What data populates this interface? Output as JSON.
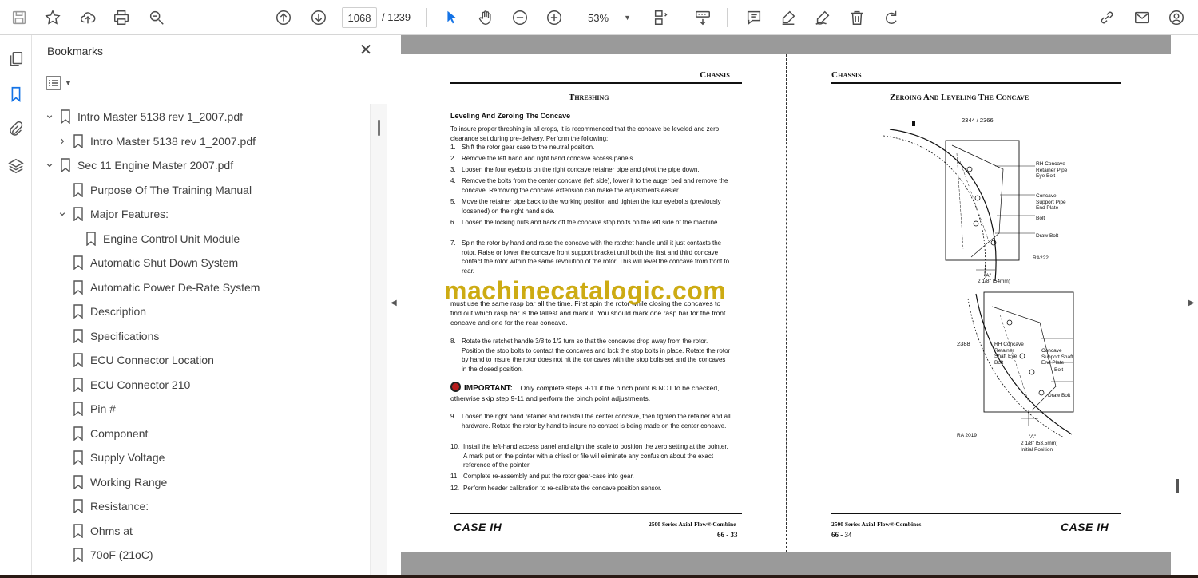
{
  "toolbar": {
    "page_current": "1068",
    "page_total": "/ 1239",
    "zoom": "53%"
  },
  "bookmarks": {
    "title": "Bookmarks",
    "items": [
      {
        "label": "Intro Master 5138 rev 1_2007.pdf",
        "level": 0,
        "chevron": "down"
      },
      {
        "label": "Intro Master 5138 rev 1_2007.pdf",
        "level": 1,
        "chevron": "right"
      },
      {
        "label": "Sec 11 Engine Master 2007.pdf",
        "level": 0,
        "chevron": "down"
      },
      {
        "label": "Purpose Of The Training Manual",
        "level": 1,
        "chevron": ""
      },
      {
        "label": "Major Features:",
        "level": 1,
        "chevron": "down"
      },
      {
        "label": "Engine Control Unit Module",
        "level": 2,
        "chevron": ""
      },
      {
        "label": "Automatic Shut Down System",
        "level": 1,
        "chevron": ""
      },
      {
        "label": "Automatic Power De-Rate System",
        "level": 1,
        "chevron": ""
      },
      {
        "label": "Description",
        "level": 1,
        "chevron": ""
      },
      {
        "label": "Specifications",
        "level": 1,
        "chevron": ""
      },
      {
        "label": "ECU Connector Location",
        "level": 1,
        "chevron": ""
      },
      {
        "label": "ECU Connector 210",
        "level": 1,
        "chevron": ""
      },
      {
        "label": "Pin #",
        "level": 1,
        "chevron": ""
      },
      {
        "label": "Component",
        "level": 1,
        "chevron": ""
      },
      {
        "label": "Supply Voltage",
        "level": 1,
        "chevron": ""
      },
      {
        "label": "Working Range",
        "level": 1,
        "chevron": ""
      },
      {
        "label": "Resistance:",
        "level": 1,
        "chevron": ""
      },
      {
        "label": "Ohms at",
        "level": 1,
        "chevron": ""
      },
      {
        "label": "70oF (21oC)",
        "level": 1,
        "chevron": ""
      }
    ]
  },
  "left_page": {
    "section": "Chassis",
    "title": "Threshing",
    "subhead": "Leveling And Zeroing The Concave",
    "intro": "To insure proper threshing in all crops, it is recommended that the concave be leveled and zero clearance set during pre-delivery. Perform the following:",
    "steps": [
      {
        "n": "1.",
        "text": "Shift the rotor gear case to the neutral position."
      },
      {
        "n": "2.",
        "text": "Remove the left hand and right hand concave access panels."
      },
      {
        "n": "3.",
        "text": "Loosen the four eyebolts on the right concave retainer pipe and pivot the pipe down."
      },
      {
        "n": "4.",
        "text": "Remove the bolts from the center concave (left side), lower it to the auger bed and remove the concave. Removing the concave extension can make the adjustments easier."
      },
      {
        "n": "5.",
        "text": "Move the retainer pipe back to the working position and tighten the four eyebolts (previously loosened) on the right hand side."
      },
      {
        "n": "6.",
        "text": "Loosen the locking nuts and back off the concave stop bolts on the left side of the machine."
      },
      {
        "n": "7.",
        "text": "Spin the rotor by hand and raise the concave with the ratchet handle until it just contacts the rotor. Raise or lower the concave front support bracket until both the first and third concave contact the rotor within the same revolution of the rotor. This will level the concave from front to rear."
      }
    ],
    "wait_text": "must use the same rasp bar all the time. First spin the rotor while closing the concaves to find out which rasp bar is the tallest and mark it. You should mark one rasp bar for the front concave and one for the rear concave.",
    "step8": {
      "n": "8.",
      "text": "Rotate the ratchet handle 3/8 to 1/2 turn so that the concaves drop away from the rotor. Position the stop bolts to contact the concaves and lock the stop bolts in place. Rotate the rotor by hand to insure the rotor does not hit the concaves with the stop bolts set and the concaves in the closed position."
    },
    "important_label": "IMPORTANT:",
    "important_text": "....Only complete steps 9-11 if the pinch point is NOT to be checked, otherwise skip step 9-11 and perform the pinch point adjustments.",
    "steps_b": [
      {
        "n": "9.",
        "text": "Loosen the right hand retainer and reinstall the center concave, then tighten the retainer and all hardware. Rotate the rotor by hand to insure no contact is being made on the center concave."
      },
      {
        "n": "10.",
        "text": "Install the left-hand access panel and align the scale to position the zero setting at the pointer. A mark put on the pointer with a chisel or file will eliminate any confusion about the exact reference of the pointer."
      },
      {
        "n": "11.",
        "text": "Complete re-assembly and put the rotor gear-case into gear."
      },
      {
        "n": "12.",
        "text": "Perform header calibration to re-calibrate the concave position sensor."
      }
    ],
    "footer_logo": "CASE IH",
    "footer_series": "2500 Series Axial-Flow® Combine",
    "footer_page": "66 - 33"
  },
  "right_page": {
    "section": "Chassis",
    "title": "Zeroing And Leveling The Concave",
    "fig1_number": "2344 / 2366",
    "fig1_labels": [
      "RH Concave Retainer Pipe Eye Bolt",
      "Concave Support Pipe End Plate",
      "Bolt",
      "Draw Bolt",
      "\"A\"",
      "2 1/8\" (54mm)",
      "RA222"
    ],
    "fig2_number": "2388",
    "fig2_labels": [
      "RH Concave Retainer Shaft Eye Bolt",
      "Concave Support Shaft End Plate",
      "Bolt",
      "Draw Bolt",
      "\"A\"",
      "2 1/8\" (53.5mm) Initial Position",
      "RA 2019"
    ],
    "footer_series": "2500 Series Axial-Flow® Combines",
    "footer_page": "66 - 34",
    "footer_logo": "CASE IH"
  },
  "watermark": "machinecatalogic.com"
}
